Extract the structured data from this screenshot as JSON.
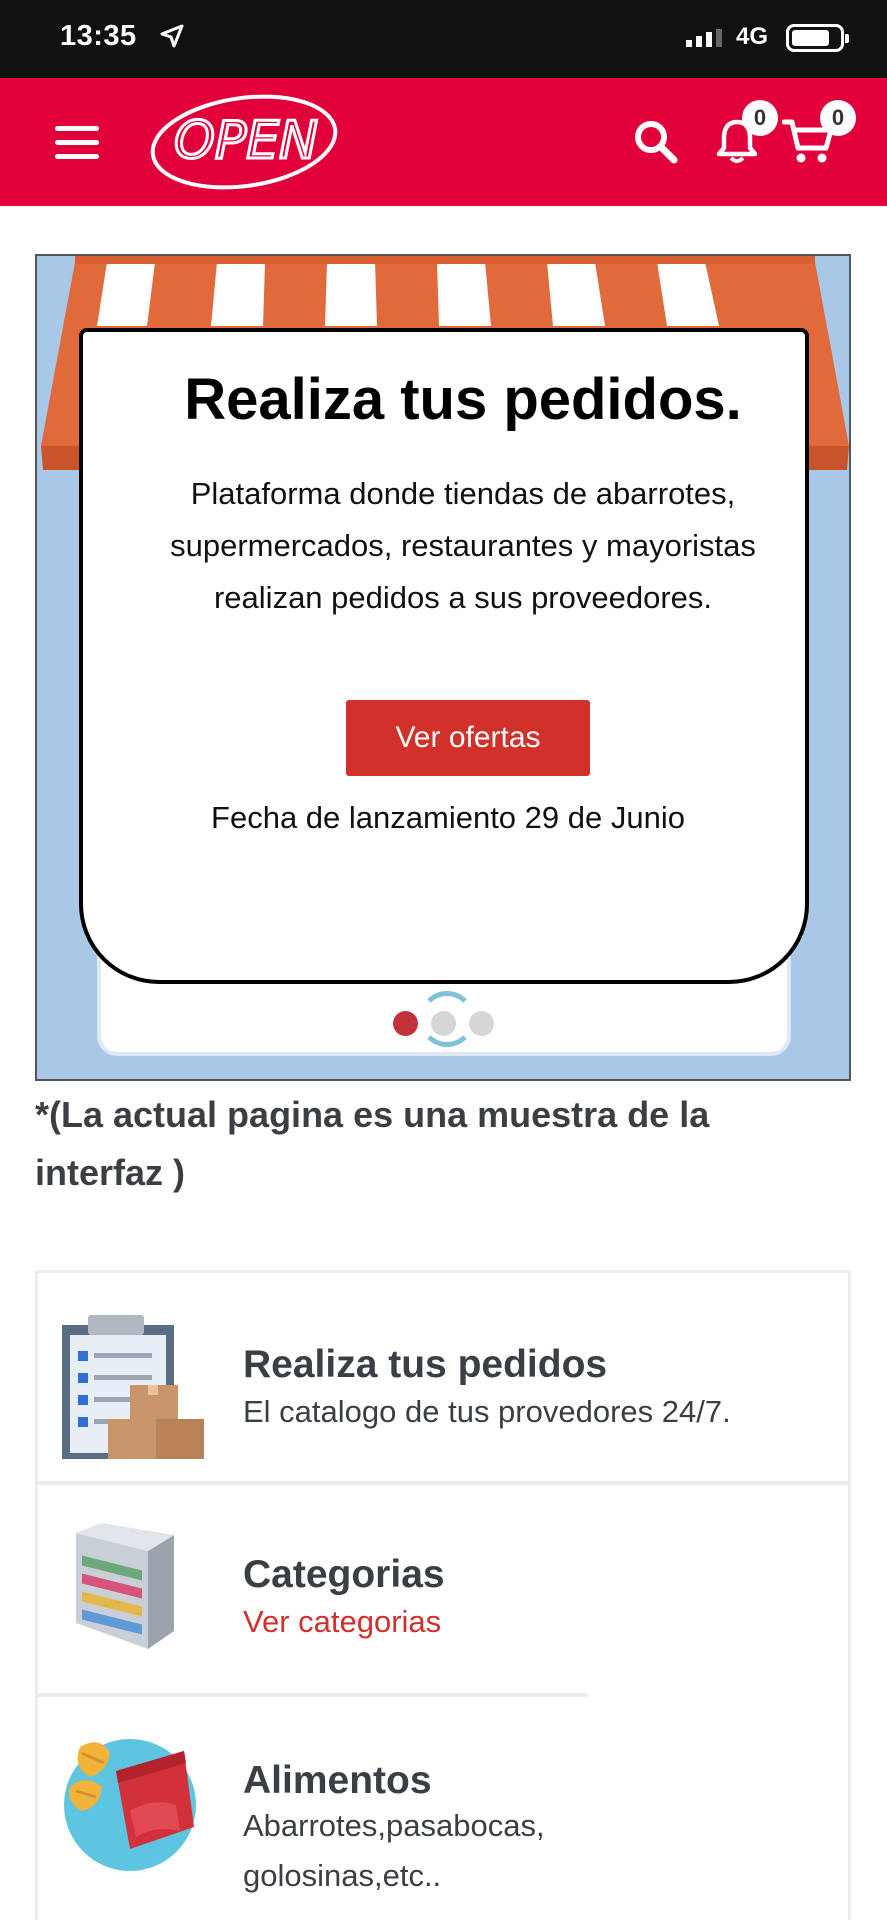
{
  "status": {
    "time": "13:35",
    "network": "4G"
  },
  "header": {
    "logo_text": "OPEN",
    "notifications_count": "0",
    "cart_count": "0"
  },
  "hero": {
    "title": "Realiza tus pedidos.",
    "description": "Plataforma donde tiendas de abarrotes, supermercados, restaurantes y mayoristas realizan pedidos a sus proveedores.",
    "button_label": "Ver ofertas",
    "launch_date": "Fecha de lanzamiento 29 de Junio",
    "slides_total": 3,
    "active_slide": 1
  },
  "disclaimer": "*(La actual pagina es una muestra de la interfaz )",
  "features": [
    {
      "title": "Realiza tus pedidos",
      "subtitle": "El catalogo de tus provedores 24/7.",
      "icon": "clipboard-boxes-icon"
    },
    {
      "title": "Categorias",
      "subtitle": "Ver categorias",
      "icon": "shelf-icon"
    },
    {
      "title": "Alimentos",
      "subtitle": "Abarrotes,pasabocas, golosinas,etc..",
      "icon": "snacks-icon"
    }
  ],
  "colors": {
    "brand": "#e1003a",
    "accent": "#d2302b",
    "hero_bg": "#a9c8e8"
  }
}
